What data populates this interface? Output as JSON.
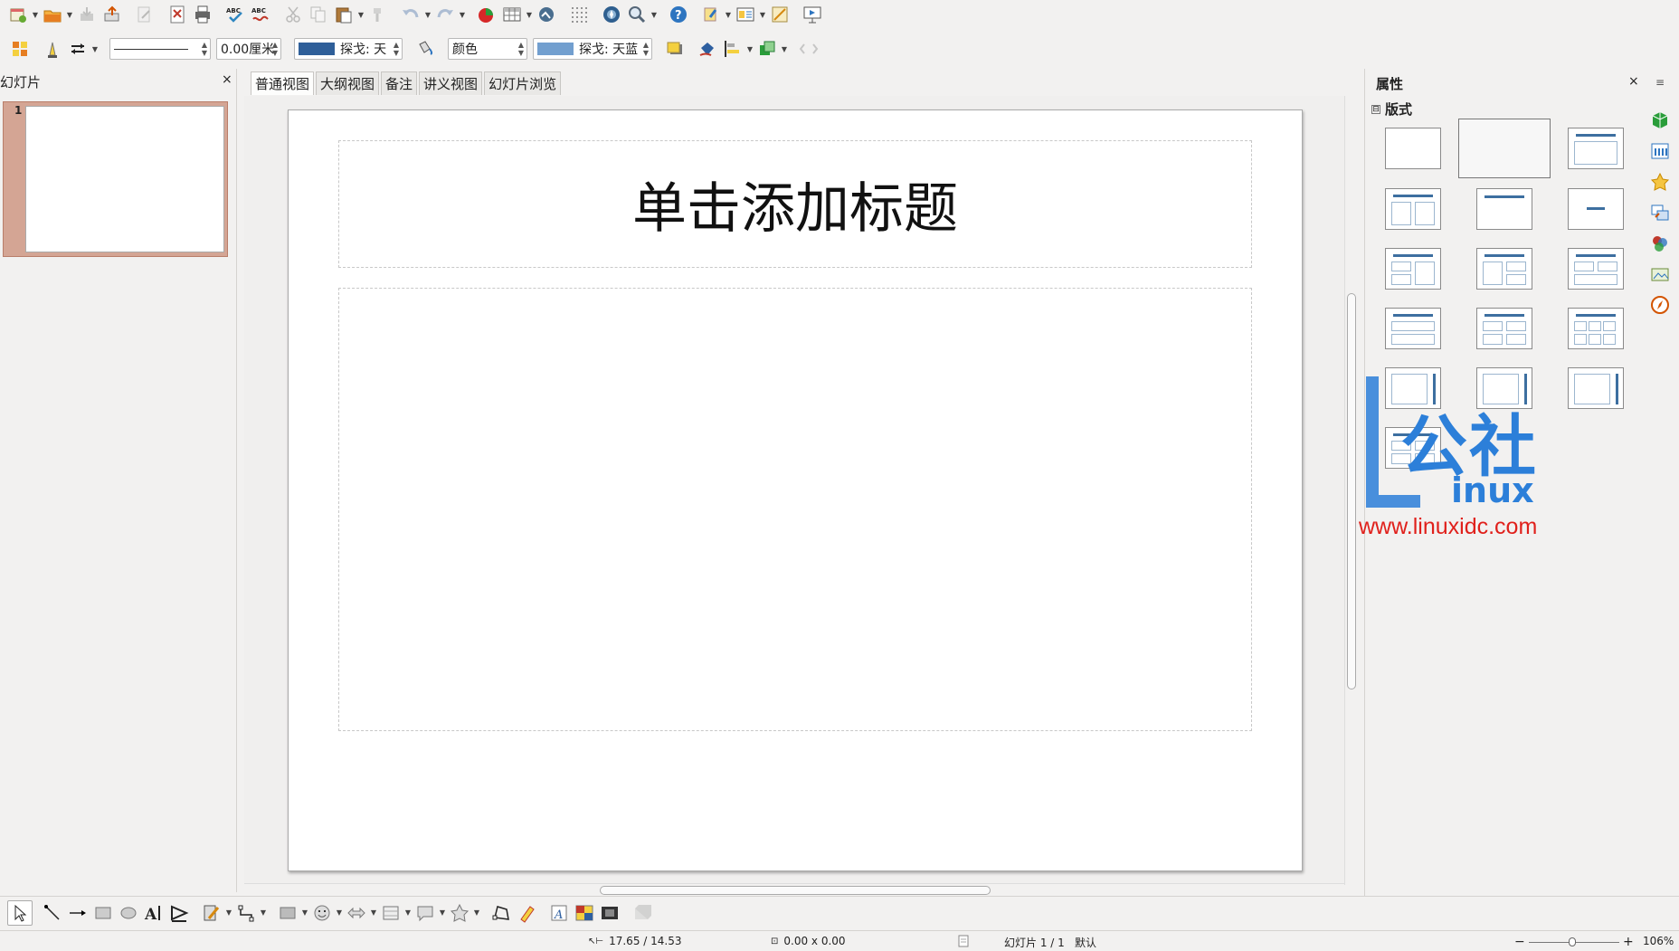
{
  "combos": {
    "line_width": "0.00厘米",
    "line_color": "探戈: 天",
    "area_style": "颜色",
    "area_color": "探戈: 天蓝"
  },
  "colors": {
    "line_color_swatch": "#2f5f99",
    "area_color_swatch": "#729fcf",
    "thumb_selection": "#d4a594",
    "layout_accent": "#3d6fa0",
    "watermark_blue": "#2c7fd9",
    "watermark_red": "#e0201b"
  },
  "slides_pane": {
    "title": "幻灯片",
    "close": "×",
    "slides": [
      {
        "number": "1"
      }
    ]
  },
  "view_tabs": [
    "普通视图",
    "大纲视图",
    "备注",
    "讲义视图",
    "幻灯片浏览"
  ],
  "slide": {
    "title_placeholder": "单击添加标题"
  },
  "properties": {
    "title": "属性",
    "close": "×",
    "section": "版式",
    "section_toggle": "⊟",
    "layouts": [
      "blank",
      "title-content",
      "title-content-alt",
      "title-2col",
      "title-only",
      "centered-text",
      "title-2col-split-left",
      "title-2col-split-right",
      "title-2row-2col",
      "title-3row",
      "title-2x2",
      "title-2x3",
      "vertical-title-content",
      "vertical-title-2col",
      "vertical-content",
      "title-4cell"
    ],
    "selected_layout": 1
  },
  "watermark": {
    "chars": "公社",
    "suffix": "inux",
    "url": "www.linuxidc.com"
  },
  "statusbar": {
    "position": "17.65 / 14.53",
    "size": "0.00 x 0.00",
    "slide_info": "幻灯片 1 / 1",
    "master": "默认",
    "zoom": "106%"
  }
}
